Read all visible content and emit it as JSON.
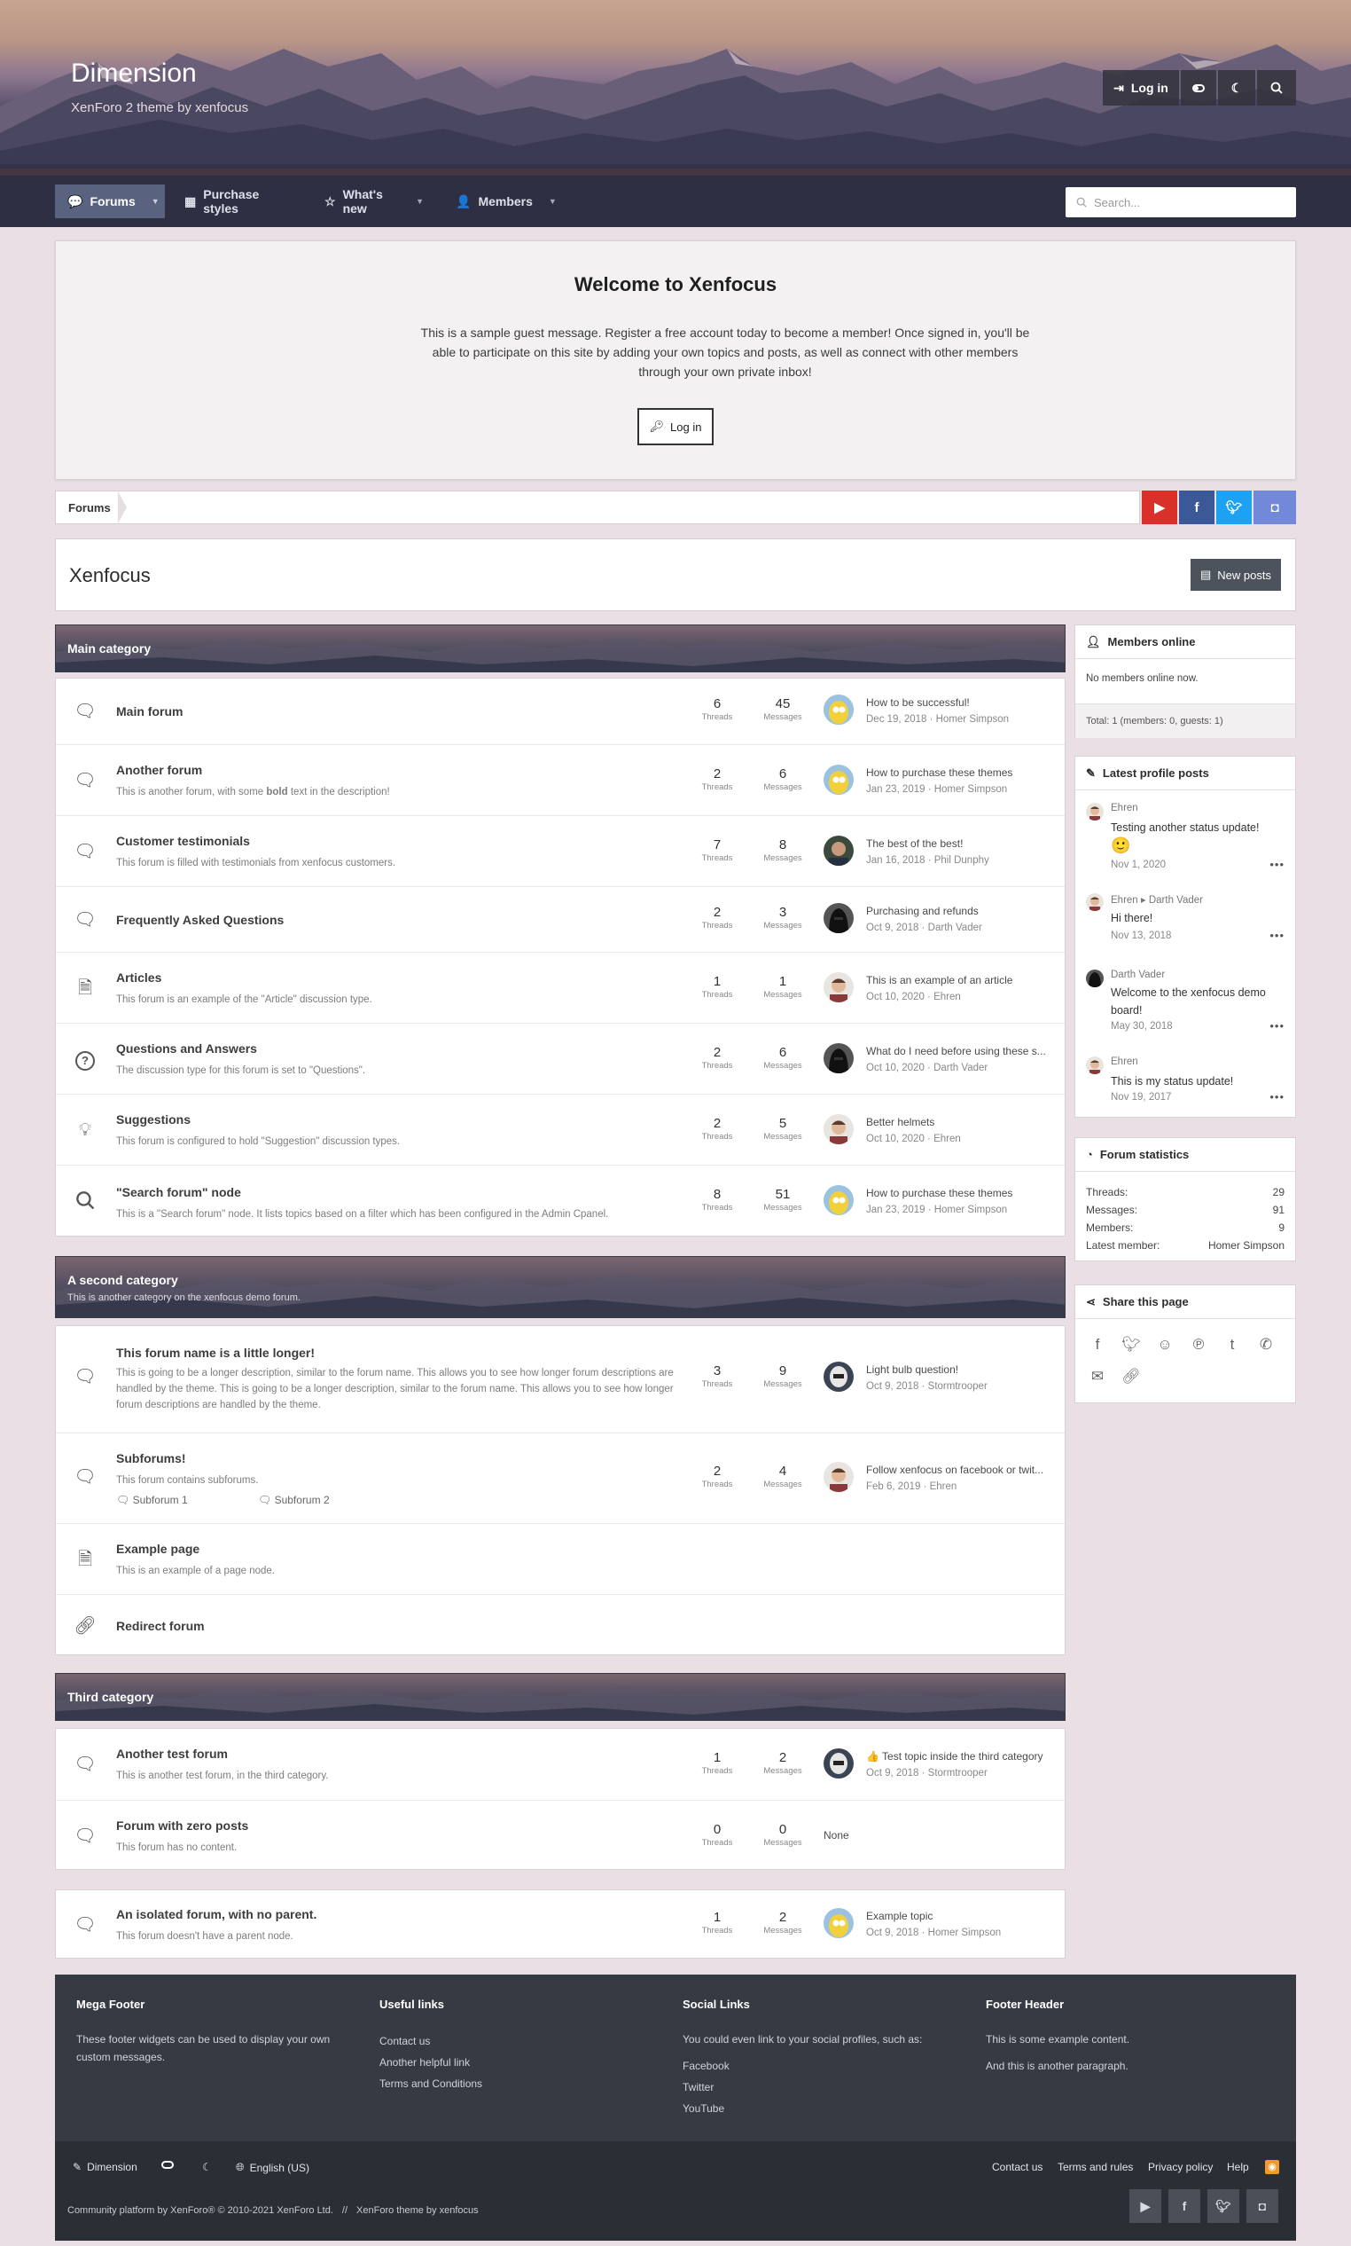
{
  "header": {
    "site_title": "Dimension",
    "site_subtitle": "XenForo 2 theme by xenfocus",
    "login_label": "Log in",
    "toggle_icon": "toggle-icon",
    "moon_icon": "moon-icon",
    "search_icon": "search-icon"
  },
  "nav": {
    "tabs": [
      {
        "label": "Forums",
        "icon": "forums-icon",
        "active": true
      },
      {
        "label": "Purchase styles",
        "icon": "grid-icon"
      },
      {
        "label": "What's new",
        "icon": "star-icon"
      },
      {
        "label": "Members",
        "icon": "user-icon"
      }
    ],
    "search_placeholder": "Search..."
  },
  "welcome": {
    "title": "Welcome to Xenfocus",
    "text": "This is a sample guest message. Register a free account today to become a member! Once signed in, you'll be able to participate on this site by adding your own topics and posts, as well as connect with other members through your own private inbox!",
    "login_label": "Log in"
  },
  "breadcrumb": {
    "label": "Forums"
  },
  "social_top": [
    {
      "icon": "youtube-icon",
      "color": "#d9312a"
    },
    {
      "icon": "facebook-icon",
      "color": "#3b5998"
    },
    {
      "icon": "twitter-icon",
      "color": "#1da1f2"
    },
    {
      "icon": "discord-icon",
      "color": "#7289da"
    }
  ],
  "page": {
    "title": "Xenfocus",
    "new_posts_label": "New posts"
  },
  "categories": [
    {
      "title": "Main category",
      "description": "",
      "nodes": [
        {
          "title": "Main forum",
          "desc": "",
          "icon": "chat-icon",
          "threads": "6",
          "messages": "45",
          "last_title": "How to be successful!",
          "last_meta": "Dec 19, 2018 · Homer Simpson",
          "avatar": "homer"
        },
        {
          "title": "Another forum",
          "desc_before": "This is another forum, with some ",
          "desc_bold": "bold",
          "desc_after": " text in the description!",
          "icon": "chat-icon",
          "threads": "2",
          "messages": "6",
          "last_title": "How to purchase these themes",
          "last_meta": "Jan 23, 2019 · Homer Simpson",
          "avatar": "homer"
        },
        {
          "title": "Customer testimonials",
          "desc": "This forum is filled with testimonials from xenfocus customers.",
          "icon": "chat-icon",
          "threads": "7",
          "messages": "8",
          "last_title": "The best of the best!",
          "last_meta": "Jan 16, 2018 · Phil Dunphy",
          "avatar": "phil"
        },
        {
          "title": "Frequently Asked Questions",
          "desc": "",
          "icon": "chat-icon",
          "threads": "2",
          "messages": "3",
          "last_title": "Purchasing and refunds",
          "last_meta": "Oct 9, 2018 · Darth Vader",
          "avatar": "vader"
        },
        {
          "title": "Articles",
          "desc": "This forum is an example of the \"Article\" discussion type.",
          "icon": "article-icon",
          "threads": "1",
          "messages": "1",
          "last_title": "This is an example of an article",
          "last_meta": "Oct 10, 2020 · Ehren",
          "avatar": "ehren"
        },
        {
          "title": "Questions and Answers",
          "desc": "The discussion type for this forum is set to \"Questions\".",
          "icon": "question-icon",
          "threads": "2",
          "messages": "6",
          "last_title": "What do I need before using these s...",
          "last_meta": "Oct 10, 2020 · Darth Vader",
          "avatar": "vader"
        },
        {
          "title": "Suggestions",
          "desc": "This forum is configured to hold \"Suggestion\" discussion types.",
          "icon": "lightbulb-icon",
          "threads": "2",
          "messages": "5",
          "last_title": "Better helmets",
          "last_meta": "Oct 10, 2020 · Ehren",
          "avatar": "ehren"
        },
        {
          "title": "\"Search forum\" node",
          "desc": "This is a \"Search forum\" node. It lists topics based on a filter which has been configured in the Admin Cpanel.",
          "icon": "search-icon",
          "threads": "8",
          "messages": "51",
          "last_title": "How to purchase these themes",
          "last_meta": "Jan 23, 2019 · Homer Simpson",
          "avatar": "homer"
        }
      ]
    },
    {
      "title": "A second category",
      "description": "This is another category on the xenfocus demo forum.",
      "nodes": [
        {
          "title": "This forum name is a little longer!",
          "desc": "This is going to be a longer description, similar to the forum name. This allows you to see how longer forum descriptions are handled by the theme. This is going to be a longer description, similar to the forum name. This allows you to see how longer forum descriptions are handled by the theme.",
          "icon": "chat-icon",
          "threads": "3",
          "messages": "9",
          "last_title": "Light bulb question!",
          "last_meta": "Oct 9, 2018 · Stormtrooper",
          "avatar": "storm"
        },
        {
          "title": "Subforums!",
          "desc": "This forum contains subforums.",
          "icon": "chat-icon",
          "threads": "2",
          "messages": "4",
          "last_title": "Follow xenfocus on facebook or twit...",
          "last_meta": "Feb 6, 2019 · Ehren",
          "avatar": "ehren",
          "subforums": [
            "Subforum 1",
            "Subforum 2"
          ]
        },
        {
          "title": "Example page",
          "desc": "This is an example of a page node.",
          "icon": "article-icon"
        },
        {
          "title": "Redirect forum",
          "desc": "",
          "icon": "link-icon"
        }
      ]
    },
    {
      "title": "Third category",
      "description": "",
      "nodes": [
        {
          "title": "Another test forum",
          "desc": "This is another test forum, in the third category.",
          "icon": "chat-icon",
          "threads": "1",
          "messages": "2",
          "last_title": "👍 Test topic inside the third category",
          "last_meta": "Oct 9, 2018 · Stormtrooper",
          "avatar": "storm"
        },
        {
          "title": "Forum with zero posts",
          "desc": "This forum has no content.",
          "icon": "chat-icon",
          "threads": "0",
          "messages": "0",
          "last_none": "None"
        }
      ]
    }
  ],
  "isolated": {
    "title": "An isolated forum, with no parent.",
    "desc": "This forum doesn't have a parent node.",
    "icon": "chat-icon",
    "threads": "1",
    "messages": "2",
    "last_title": "Example topic",
    "last_meta": "Oct 9, 2018 · Homer Simpson",
    "avatar": "homer"
  },
  "labels": {
    "threads": "Threads",
    "messages": "Messages"
  },
  "sidebar": {
    "members_online": {
      "title": "Members online",
      "text": "No members online now.",
      "total": "Total: 1 (members: 0, guests: 1)"
    },
    "profile_posts": {
      "title": "Latest profile posts",
      "posts": [
        {
          "name": "Ehren",
          "msg": "Testing another status update!",
          "emoji": "🙂",
          "date": "Nov 1, 2020",
          "avatar": "ehren"
        },
        {
          "name": "Ehren ▸ Darth Vader",
          "msg": "Hi there!",
          "date": "Nov 13, 2018",
          "avatar": "ehren"
        },
        {
          "name": "Darth Vader",
          "msg": "Welcome to the xenfocus demo board!",
          "date": "May 30, 2018",
          "avatar": "vader"
        },
        {
          "name": "Ehren",
          "msg": "This is my status update!",
          "date": "Nov 19, 2017",
          "avatar": "ehren"
        }
      ]
    },
    "stats": {
      "title": "Forum statistics",
      "rows": [
        {
          "label": "Threads:",
          "value": "29"
        },
        {
          "label": "Messages:",
          "value": "91"
        },
        {
          "label": "Members:",
          "value": "9"
        },
        {
          "label": "Latest member:",
          "value": "Homer Simpson"
        }
      ]
    },
    "share": {
      "title": "Share this page"
    }
  },
  "footer": {
    "columns": [
      {
        "title": "Mega Footer",
        "text": "These footer widgets can be used to display your own custom messages."
      },
      {
        "title": "Useful links",
        "links": [
          "Contact us",
          "Another helpful link",
          "Terms and Conditions"
        ]
      },
      {
        "title": "Social Links",
        "text": "You could even link to your social profiles, such as:",
        "links": [
          "Facebook",
          "Twitter",
          "YouTube"
        ]
      },
      {
        "title": "Footer Header",
        "text": "This is some example content.",
        "text2": "And this is another paragraph."
      }
    ],
    "bottom": {
      "style_label": "Dimension",
      "language_label": "English (US)",
      "links": [
        "Contact us",
        "Terms and rules",
        "Privacy policy",
        "Help"
      ],
      "copyright": "Community platform by XenForo® © 2010-2021 XenForo Ltd.",
      "separator": "//",
      "theme_credit": "XenForo theme by xenfocus"
    }
  }
}
